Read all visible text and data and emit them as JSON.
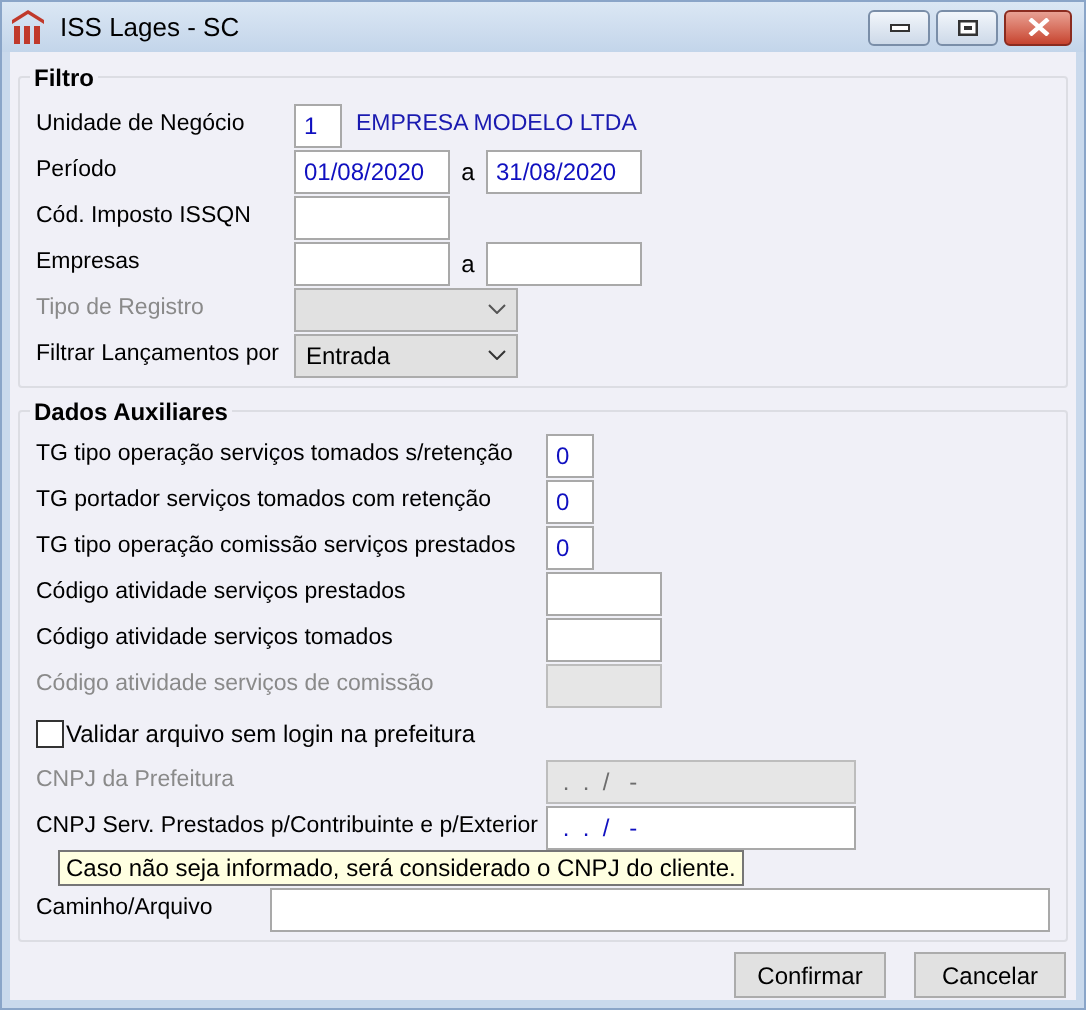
{
  "window": {
    "title": "ISS Lages - SC"
  },
  "filtro": {
    "title": "Filtro",
    "rows": [
      {
        "kind": "code",
        "label": "Unidade de Negócio",
        "value": "1",
        "description": "EMPRESA MODELO LTDA"
      },
      {
        "kind": "range",
        "label": "Período",
        "from": "01/08/2020",
        "separator": "a",
        "to": "31/08/2020"
      },
      {
        "kind": "text",
        "label": "Cód. Imposto ISSQN",
        "value": ""
      },
      {
        "kind": "range",
        "label": "Empresas",
        "from": "",
        "separator": "a",
        "to": ""
      },
      {
        "kind": "select",
        "label": "Tipo de Registro",
        "value": "",
        "disabled": true
      },
      {
        "kind": "select",
        "label": "Filtrar Lançamentos por",
        "value": "Entrada",
        "disabled": false
      }
    ]
  },
  "dados_auxiliares": {
    "title": "Dados Auxiliares",
    "rows": [
      {
        "kind": "small",
        "label": "TG tipo operação serviços tomados s/retenção",
        "value": "0",
        "disabled": false
      },
      {
        "kind": "small",
        "label": "TG portador serviços tomados com retenção",
        "value": "0",
        "disabled": false
      },
      {
        "kind": "small",
        "label": "TG tipo operação comissão serviços prestados",
        "value": "0",
        "disabled": false
      },
      {
        "kind": "medium",
        "label": "Código atividade serviços prestados",
        "value": "",
        "disabled": false
      },
      {
        "kind": "medium",
        "label": "Código atividade serviços tomados",
        "value": "",
        "disabled": false
      },
      {
        "kind": "medium",
        "label": "Código atividade serviços de comissão",
        "value": "",
        "disabled": true
      },
      {
        "kind": "checkbox",
        "label": "Validar arquivo sem login na prefeitura",
        "checked": false
      },
      {
        "kind": "wide",
        "label": "CNPJ da Prefeitura",
        "value": " .  .  /   -",
        "disabled": true
      },
      {
        "kind": "wide",
        "label": "CNPJ Serv. Prestados p/Contribuinte e p/Exterior",
        "value": " .  .  /   -",
        "disabled": false
      },
      {
        "kind": "path",
        "label": "Caminho/Arquivo",
        "value": "",
        "disabled": false
      }
    ]
  },
  "tooltip": "Caso não seja informado, será considerado o CNPJ do cliente.",
  "buttons": [
    "Confirmar",
    "Cancelar"
  ]
}
